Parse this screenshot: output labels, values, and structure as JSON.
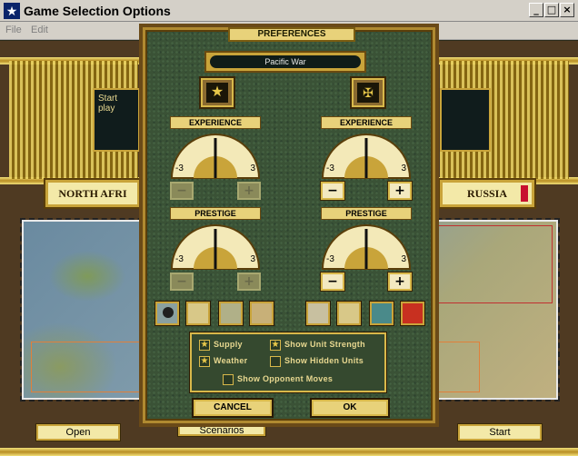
{
  "window": {
    "title": "Game Selection Options",
    "icon": "star-icon"
  },
  "menu": {
    "items": [
      "File",
      "Edit"
    ]
  },
  "background": {
    "message": "Start play",
    "nation_left": "NORTH AFRI",
    "nation_right": "RUSSIA",
    "buttons": {
      "open": "Open",
      "scenarios": "Scenarios",
      "start": "Start"
    }
  },
  "prefs": {
    "title": "PREFERENCES",
    "scenario": "Pacific War",
    "left": {
      "flag_icon": "allied-star-icon",
      "experience_label": "EXPERIENCE",
      "experience_min": "-3",
      "experience_max": "3",
      "prestige_label": "PRESTIGE",
      "prestige_min": "-3",
      "prestige_max": "3",
      "minus": "−",
      "plus": "+"
    },
    "right": {
      "flag_icon": "axis-eagle-icon",
      "experience_label": "EXPERIENCE",
      "experience_min": "-3",
      "experience_max": "3",
      "prestige_label": "PRESTIGE",
      "prestige_min": "-3",
      "prestige_max": "3",
      "minus": "−",
      "plus": "+"
    },
    "options": {
      "supply": "Supply",
      "weather": "Weather",
      "show_unit_strength": "Show Unit Strength",
      "show_hidden_units": "Show Hidden Units",
      "show_opponent_moves": "Show Opponent Moves"
    },
    "cancel": "CANCEL",
    "ok": "OK"
  }
}
